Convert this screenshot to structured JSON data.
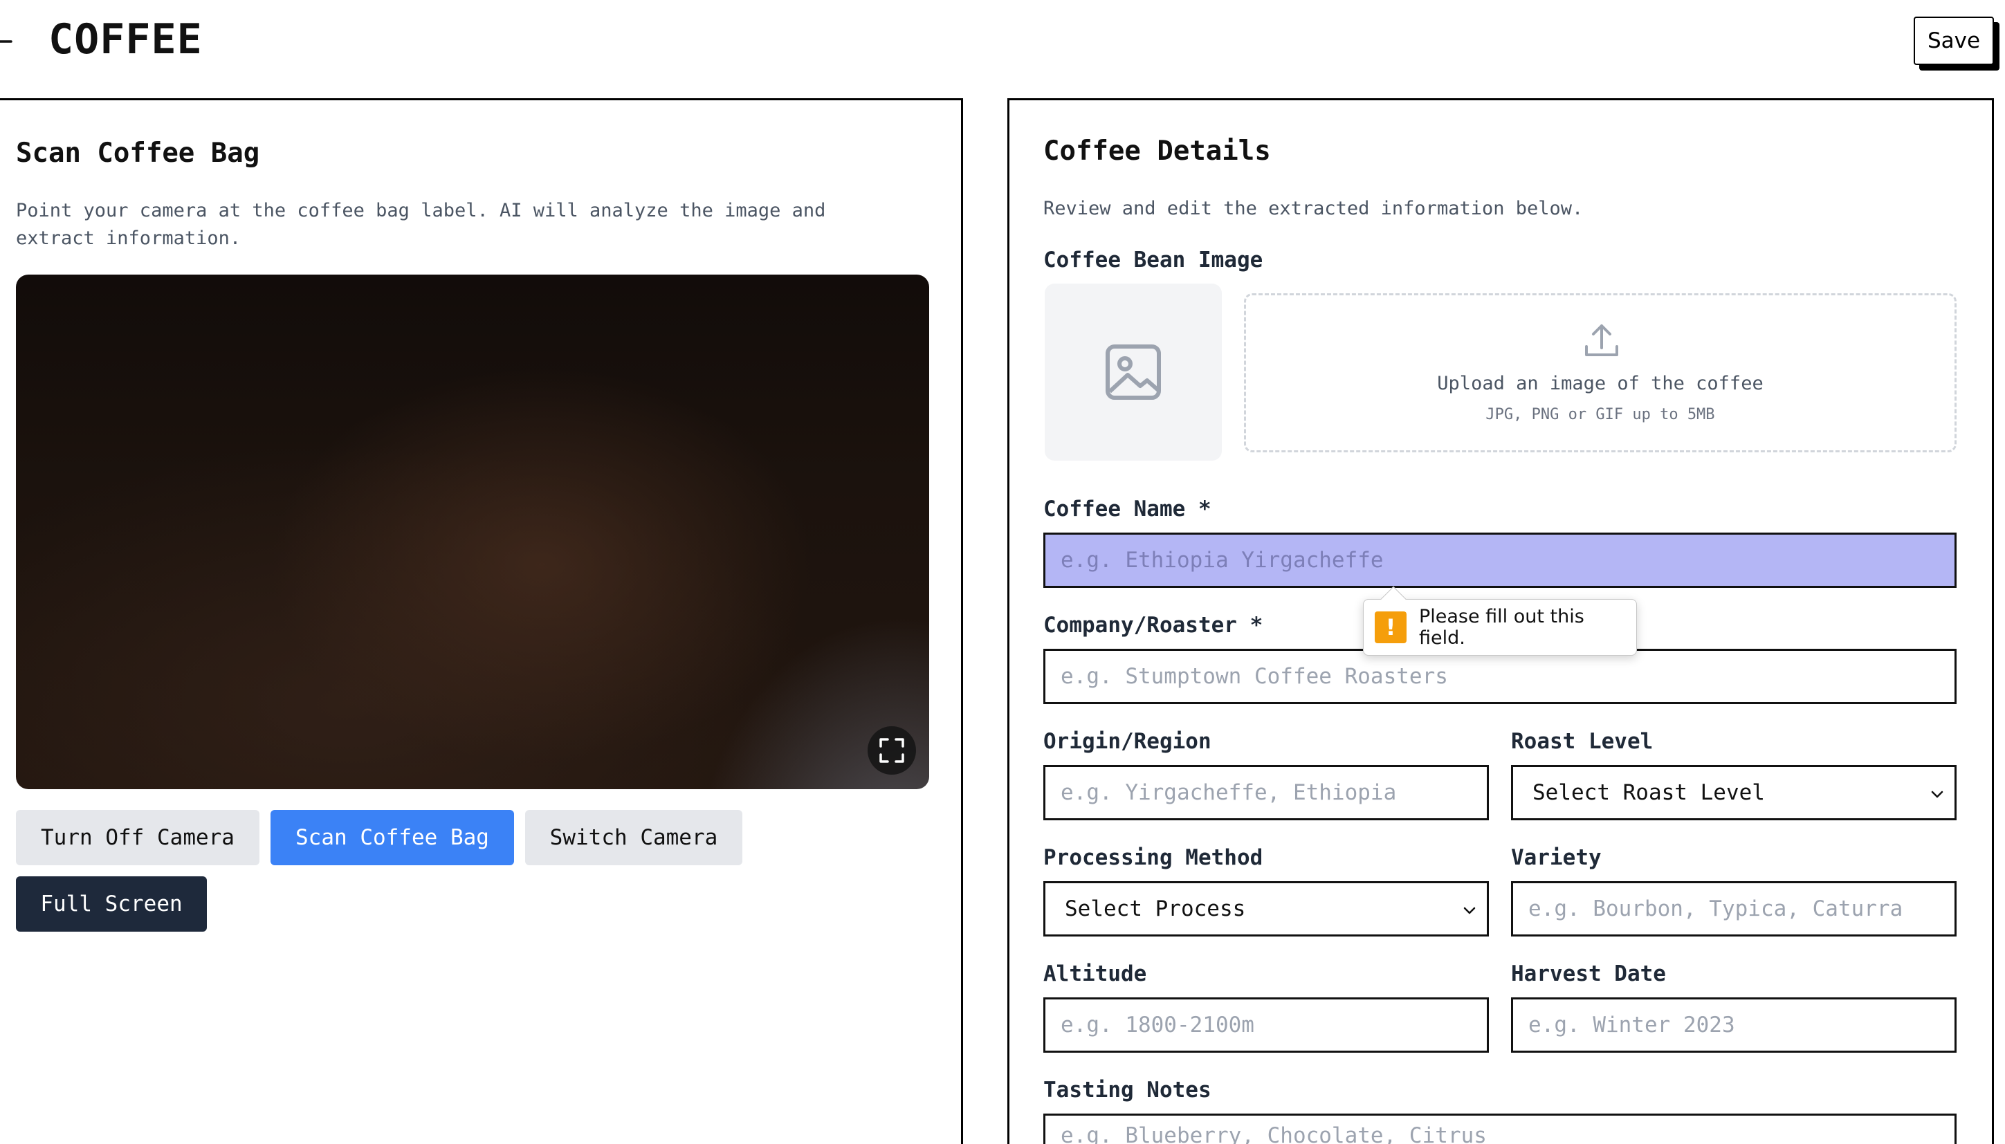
{
  "header": {
    "title": "COFFEE",
    "save_label": "Save"
  },
  "scan_panel": {
    "title": "Scan Coffee Bag",
    "description_line1": "Point your camera at the coffee bag label. AI will analyze the image and",
    "description_line2": "extract information.",
    "buttons": {
      "turn_off_camera": "Turn Off Camera",
      "scan": "Scan Coffee Bag",
      "switch_camera": "Switch Camera",
      "full_screen": "Full Screen"
    }
  },
  "details_panel": {
    "title": "Coffee Details",
    "description": "Review and edit the extracted information below.",
    "image_section": {
      "label": "Coffee Bean Image",
      "upload_title": "Upload an image of the coffee",
      "upload_hint": "JPG, PNG or GIF up to 5MB"
    },
    "fields": {
      "coffee_name": {
        "label": "Coffee Name *",
        "placeholder": "e.g. Ethiopia Yirgacheffe",
        "value": ""
      },
      "company": {
        "label": "Company/Roaster *",
        "placeholder": "e.g. Stumptown Coffee Roasters",
        "value": ""
      },
      "origin": {
        "label": "Origin/Region",
        "placeholder": "e.g. Yirgacheffe, Ethiopia",
        "value": ""
      },
      "roast_level": {
        "label": "Roast Level",
        "selected": "Select Roast Level"
      },
      "processing_method": {
        "label": "Processing Method",
        "selected": "Select Process"
      },
      "variety": {
        "label": "Variety",
        "placeholder": "e.g. Bourbon, Typica, Caturra",
        "value": ""
      },
      "altitude": {
        "label": "Altitude",
        "placeholder": "e.g. 1800-2100m",
        "value": ""
      },
      "harvest_date": {
        "label": "Harvest Date",
        "placeholder": "e.g. Winter 2023",
        "value": ""
      },
      "tasting_notes": {
        "label": "Tasting Notes",
        "placeholder": "e.g. Blueberry, Chocolate, Citrus",
        "value": ""
      }
    },
    "validation_tooltip": {
      "icon": "!",
      "message": "Please fill out this field."
    }
  },
  "colors": {
    "accent_blue": "#3b82f6",
    "focused_input": "#b4b6f5",
    "dark_button": "#1e293b",
    "warning": "#f59e0b"
  },
  "icons": {
    "back": "arrow-left-icon",
    "fullscreen": "expand-icon",
    "image_placeholder": "image-icon",
    "upload": "upload-icon",
    "select": "chevron-down-icon",
    "warning": "warning-icon"
  }
}
